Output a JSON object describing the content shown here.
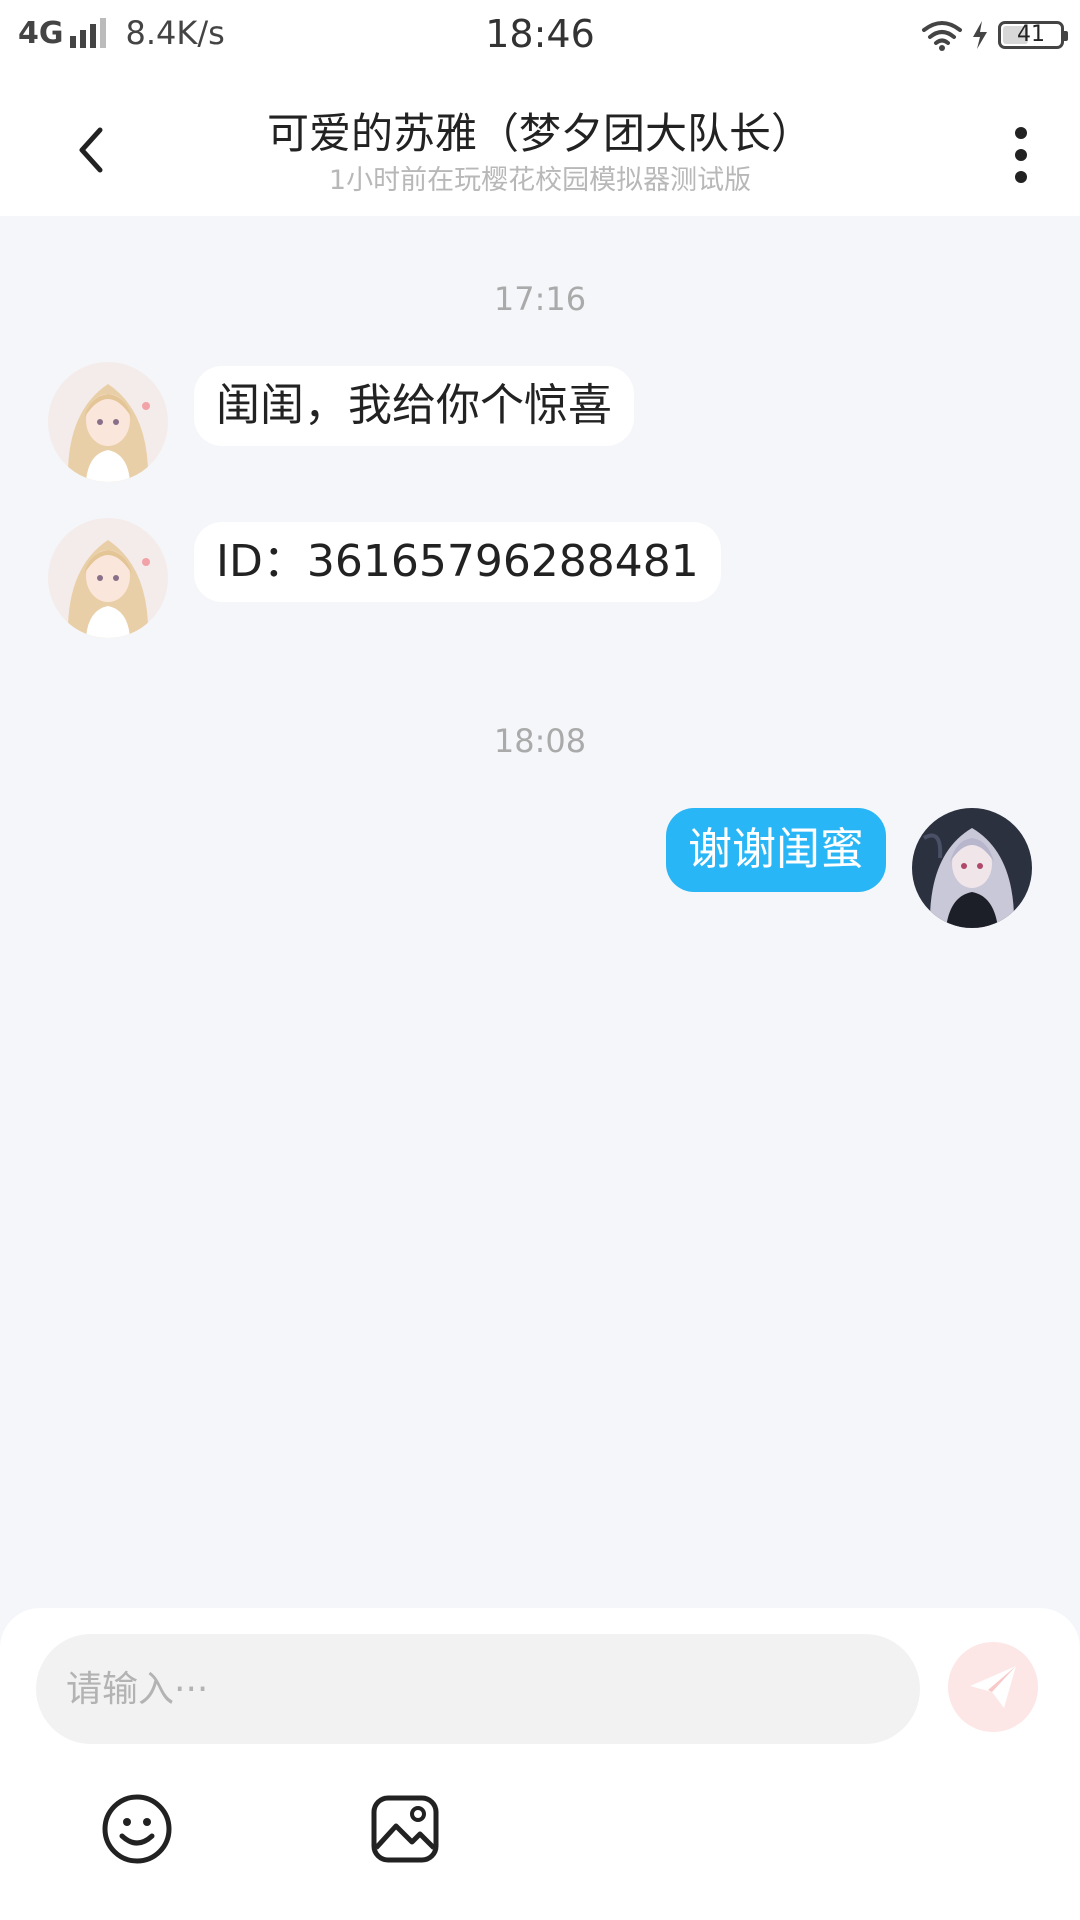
{
  "status_bar": {
    "network": "4G",
    "speed": "8.4K/s",
    "time": "18:46",
    "battery": "41"
  },
  "header": {
    "title": "可爱的苏雅（梦夕团大队长）",
    "subtitle": "1小时前在玩樱花校园模拟器测试版"
  },
  "messages": [
    {
      "timestamp": "17:16"
    },
    {
      "from": "other",
      "text": "闺闺，我给你个惊喜"
    },
    {
      "from": "other",
      "text": "ID：36165796288481"
    },
    {
      "timestamp": "18:08"
    },
    {
      "from": "me",
      "text": "谢谢闺蜜"
    }
  ],
  "input": {
    "placeholder": "请输入···"
  },
  "colors": {
    "accent_blue": "#29b6f6",
    "background": "#f4f6f9",
    "send_button": "#fde6e6"
  },
  "icons": {
    "back": "chevron-left-icon",
    "more": "more-vertical-icon",
    "send": "paper-plane-icon",
    "emoji": "smiley-icon",
    "image": "image-icon"
  }
}
